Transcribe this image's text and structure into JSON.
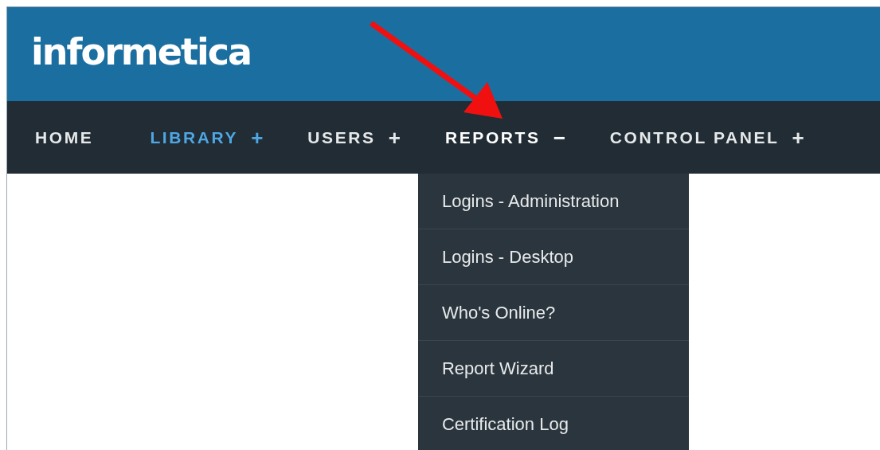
{
  "header": {
    "logo": "informetica"
  },
  "nav": {
    "items": [
      {
        "label": "HOME",
        "selected": false
      },
      {
        "label": "LIBRARY",
        "selected": true,
        "toggle": "+",
        "expanded": false
      },
      {
        "label": "USERS",
        "selected": false,
        "toggle": "+",
        "expanded": false
      },
      {
        "label": "REPORTS",
        "selected": false,
        "toggle": "−",
        "expanded": true,
        "menu": [
          "Logins - Administration",
          "Logins - Desktop",
          "Who's Online?",
          "Report Wizard",
          "Certification Log"
        ]
      },
      {
        "label": "CONTROL PANEL",
        "selected": false,
        "toggle": "+",
        "expanded": false
      }
    ]
  }
}
